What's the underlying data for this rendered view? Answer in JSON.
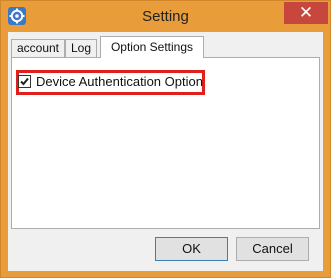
{
  "window": {
    "title": "Setting",
    "close_label": "✕",
    "accent_color": "#e99c3a",
    "icon": "app-gear-icon"
  },
  "tabs": [
    {
      "label": "account",
      "active": false
    },
    {
      "label": "Log",
      "active": false
    },
    {
      "label": "Option Settings",
      "active": true
    }
  ],
  "options": {
    "device_auth": {
      "label": "Device Authentication Option",
      "checked": true,
      "highlight_color": "#e0201c"
    }
  },
  "buttons": {
    "ok_label": "OK",
    "cancel_label": "Cancel"
  }
}
